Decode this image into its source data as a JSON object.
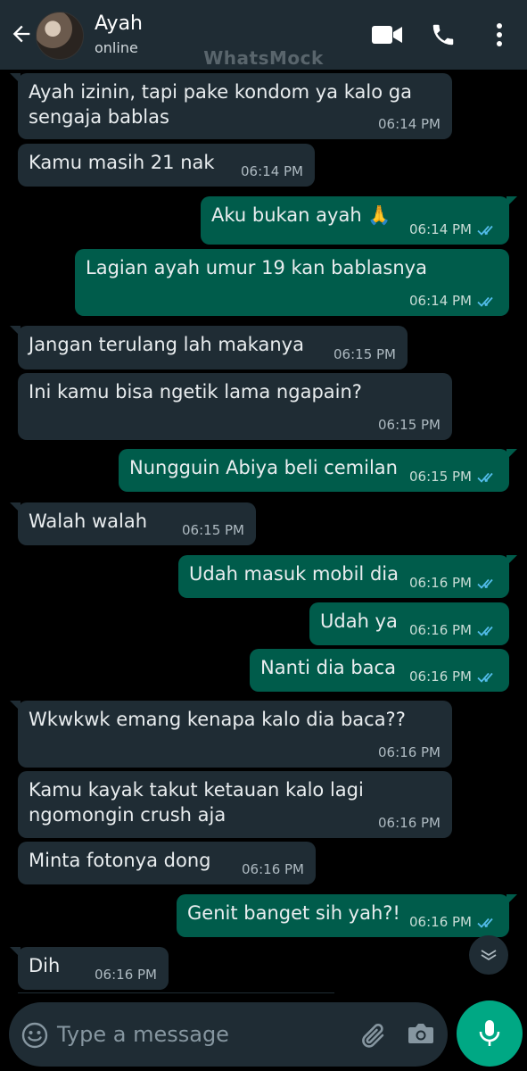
{
  "header": {
    "contact_name": "Ayah",
    "status": "online",
    "watermark": "WhatsMock",
    "icons": [
      "back-arrow-icon",
      "video-call-icon",
      "voice-call-icon",
      "more-options-icon"
    ]
  },
  "messages": [
    {
      "dir": "in",
      "lines": [
        "Ayah izinin, tapi pake kondom ya kalo ga",
        "sengaja bablas"
      ],
      "time": "06:14 PM"
    },
    {
      "dir": "in",
      "lines": [
        "Kamu masih 21 nak"
      ],
      "time": "06:14 PM"
    },
    {
      "dir": "out",
      "lines": [
        "Aku bukan ayah 🙏"
      ],
      "time": "06:14 PM"
    },
    {
      "dir": "out",
      "lines": [
        "Lagian ayah umur 19 kan bablasnya"
      ],
      "time": "06:14 PM"
    },
    {
      "dir": "in",
      "lines": [
        "Jangan terulang lah makanya"
      ],
      "time": "06:15 PM"
    },
    {
      "dir": "in",
      "lines": [
        "Ini kamu bisa ngetik lama ngapain?"
      ],
      "time": "06:15 PM"
    },
    {
      "dir": "out",
      "lines": [
        "Nungguin Abiya beli cemilan"
      ],
      "time": "06:15 PM"
    },
    {
      "dir": "in",
      "lines": [
        "Walah walah"
      ],
      "time": "06:15 PM"
    },
    {
      "dir": "out",
      "lines": [
        "Udah masuk mobil dia"
      ],
      "time": "06:16 PM"
    },
    {
      "dir": "out",
      "lines": [
        "Udah ya"
      ],
      "time": "06:16 PM"
    },
    {
      "dir": "out",
      "lines": [
        "Nanti dia baca"
      ],
      "time": "06:16 PM"
    },
    {
      "dir": "in",
      "lines": [
        "Wkwkwk emang kenapa kalo dia baca??"
      ],
      "time": "06:16 PM"
    },
    {
      "dir": "in",
      "lines": [
        "Kamu kayak takut ketauan kalo lagi",
        "ngomongin crush aja"
      ],
      "time": "06:16 PM"
    },
    {
      "dir": "in",
      "lines": [
        "Minta fotonya dong"
      ],
      "time": "06:16 PM"
    },
    {
      "dir": "out",
      "lines": [
        "Genit banget sih yah?!"
      ],
      "time": "06:16 PM"
    },
    {
      "dir": "in",
      "lines": [
        "Dih"
      ],
      "time": "06:16 PM"
    }
  ],
  "composer": {
    "placeholder": "Type a message",
    "icons": [
      "emoji-icon",
      "attach-icon",
      "camera-icon",
      "mic-icon"
    ]
  },
  "colors": {
    "header_bg": "#1f2c34",
    "incoming_bubble": "#1f2c34",
    "outgoing_bubble": "#005c4b",
    "read_ticks": "#53bdeb",
    "accent": "#00a884"
  }
}
